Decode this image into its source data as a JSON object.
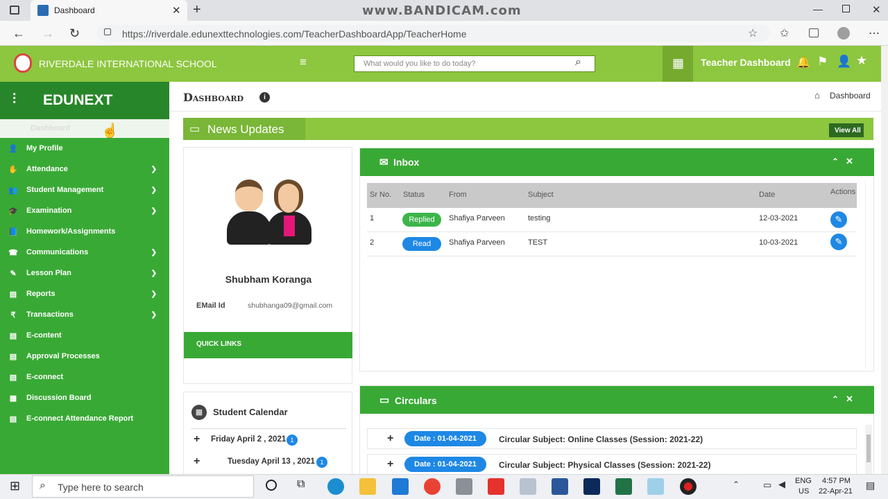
{
  "browser": {
    "tab_title": "Dashboard",
    "url": "https://riverdale.edunexttechnologies.com/TeacherDashboardApp/TeacherHome",
    "watermark": "www.BANDICAM.com"
  },
  "header": {
    "school_name": "RIVERDALE INTERNATIONAL SCHOOL",
    "search_placeholder": "What would you like to do today?",
    "dashboard_label": "Teacher Dashboard"
  },
  "sidebar": {
    "brand": "EDUNEXT",
    "active_item": "Dashboard",
    "items": [
      {
        "label": "My Profile",
        "icon": "user-icon",
        "glyph": "👤",
        "chevron": false
      },
      {
        "label": "Attendance",
        "icon": "hand-icon",
        "glyph": "✋",
        "chevron": true
      },
      {
        "label": "Student Management",
        "icon": "users-icon",
        "glyph": "👥",
        "chevron": true
      },
      {
        "label": "Examination",
        "icon": "graduation-cap-icon",
        "glyph": "🎓",
        "chevron": true
      },
      {
        "label": "Homework/Assignments",
        "icon": "book-icon",
        "glyph": "📘",
        "chevron": false
      },
      {
        "label": "Communications",
        "icon": "phone-icon",
        "glyph": "☎",
        "chevron": true
      },
      {
        "label": "Lesson Plan",
        "icon": "edit-icon",
        "glyph": "✎",
        "chevron": true
      },
      {
        "label": "Reports",
        "icon": "report-icon",
        "glyph": "▤",
        "chevron": true
      },
      {
        "label": "Transactions",
        "icon": "rupee-icon",
        "glyph": "₹",
        "chevron": true
      },
      {
        "label": "E-content",
        "icon": "document-icon",
        "glyph": "▤",
        "chevron": false
      },
      {
        "label": "Approval Processes",
        "icon": "document-icon",
        "glyph": "▤",
        "chevron": false
      },
      {
        "label": "E-connect",
        "icon": "document-icon",
        "glyph": "▤",
        "chevron": false
      },
      {
        "label": "Discussion Board",
        "icon": "chat-icon",
        "glyph": "▦",
        "chevron": false
      },
      {
        "label": "E-connect Attendance Report",
        "icon": "document-icon",
        "glyph": "▤",
        "chevron": false
      }
    ]
  },
  "page": {
    "title": "Dashboard",
    "breadcrumb": "Dashboard",
    "news_title": "News Updates",
    "view_all": "View All"
  },
  "profile": {
    "name": "Shubham Koranga",
    "email_label": "EMail Id",
    "email": "shubhanga09@gmail.com",
    "quick_links": "QUICK LINKS"
  },
  "inbox": {
    "title": "Inbox",
    "columns": [
      "Sr No.",
      "Status",
      "From",
      "Subject",
      "Date",
      "Actions"
    ],
    "rows": [
      {
        "sr": "1",
        "status": "Replied",
        "status_color": "#3cb54a",
        "from": "Shafiya Parveen",
        "subject": "testing",
        "date": "12-03-2021"
      },
      {
        "sr": "2",
        "status": "Read",
        "status_color": "#1e88e5",
        "from": "Shafiya Parveen",
        "subject": "TEST",
        "date": "10-03-2021"
      }
    ]
  },
  "calendar": {
    "title": "Student Calendar",
    "entries": [
      {
        "date": "Friday April 2 , 2021",
        "count": "1"
      },
      {
        "date": "Tuesday April 13 , 2021",
        "count": "1"
      }
    ]
  },
  "circulars": {
    "title": "Circulars",
    "items": [
      {
        "date": "Date : 01-04-2021",
        "subject": "Circular Subject: Online Classes (Session: 2021-22)"
      },
      {
        "date": "Date : 01-04-2021",
        "subject": "Circular Subject: Physical Classes (Session: 2021-22)"
      }
    ]
  },
  "taskbar": {
    "search_placeholder": "Type here to search",
    "lang": "ENG",
    "region": "US",
    "time": "4:57 PM",
    "date": "22-Apr-21"
  }
}
